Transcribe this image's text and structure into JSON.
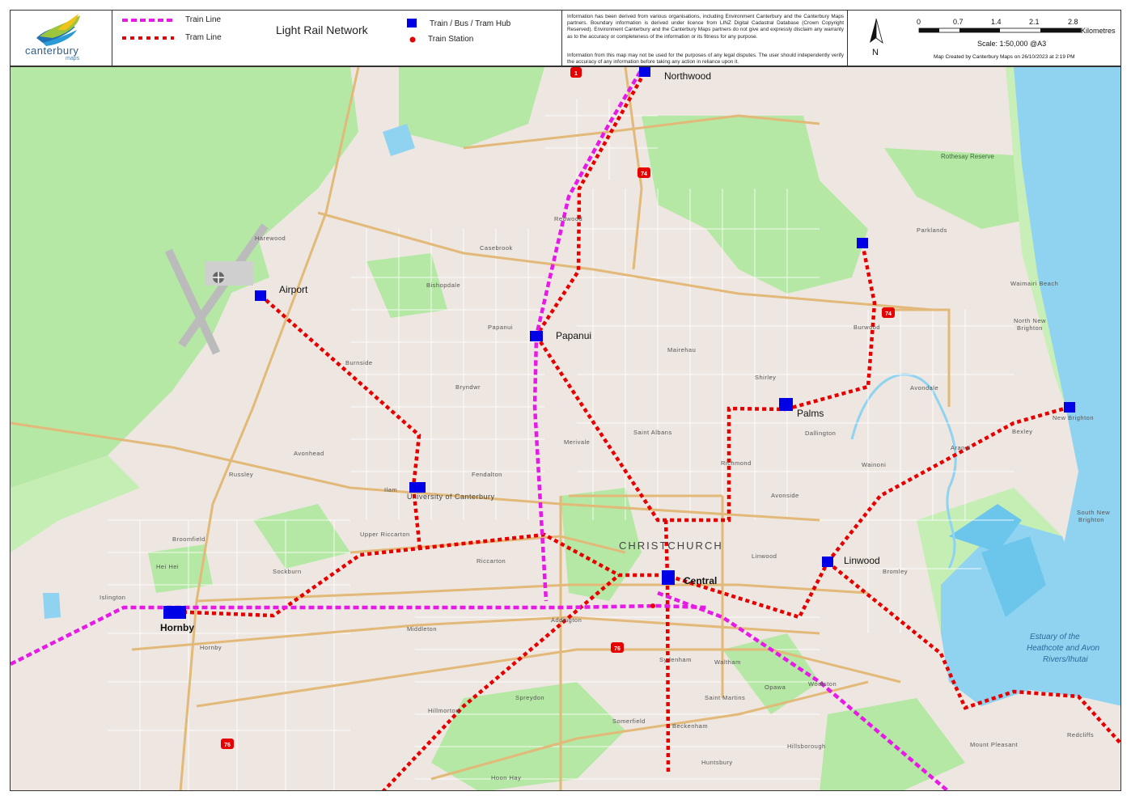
{
  "header": {
    "logo": {
      "word": "canterbury",
      "sub": "maps"
    },
    "legend": {
      "train_line": "Train Line",
      "tram_line": "Tram Line",
      "hub": "Train / Bus / Tram Hub",
      "station": "Train Station"
    },
    "title": "Light Rail Network",
    "disclaimer": [
      "Information has been derived from various organisations, including Environment Canterbury and the Canterbury Maps partners. Boundary information is derived under licence from LINZ Digital Cadastral Database (Crown Copyright Reserved). Environment Canterbury and the Canterbury Maps partners do not give and expressly disclaim any warranty as to the accuracy or completeness of the information or its fitness for any purpose.",
      "Information from this map may not be used for the purposes of any legal disputes. The user should independently verify the accuracy of any information before taking any action in reliance upon it."
    ],
    "north": "N",
    "scale": {
      "ticks": [
        "0",
        "0.7",
        "1.4",
        "2.1",
        "2.8"
      ],
      "unit": "Kilometres",
      "ratio": "Scale: 1:50,000 @A3"
    },
    "created": "Map Created by Canterbury Maps on 26/10/2023 at 2:19 PM"
  },
  "colors": {
    "train": "#e619e6",
    "tram": "#e60000",
    "hub": "#0000e6",
    "water": "#8fd3f0",
    "park": "#b4e8a4",
    "land": "#eee7e1",
    "road": "#e2b978"
  },
  "hubs": {
    "northwood": "Northwood",
    "airport": "Airport",
    "papanui": "Papanui",
    "palms": "Palms",
    "university": "University of Canterbury",
    "hornby": "Hornby",
    "central": "Central",
    "linwood": "Linwood"
  },
  "places": {
    "christchurch": "CHRISTCHURCH",
    "estuary": [
      "Estuary of the",
      "Heathcote and Avon",
      "Rivers/Ihutai"
    ],
    "rothesay": "Rothesay Reserve",
    "harewood": "Harewood",
    "redwood": "Redwood",
    "casebrook": "Casebrook",
    "bishopdale": "Bishopdale",
    "papanui": "Papanui",
    "burnside": "Burnside",
    "bryndwr": "Bryndwr",
    "mairehau": "Mairehau",
    "shirley": "Shirley",
    "parklands": "Parklands",
    "burwood": "Burwood",
    "waimairi": "Waimairi Beach",
    "north_new_brighton": [
      "North New",
      "Brighton"
    ],
    "avondale": "Avondale",
    "new_brighton": "New Brighton",
    "dallington": "Dallington",
    "st_albans": "Saint Albans",
    "merivale": "Merivale",
    "avonhead": "Avonhead",
    "russley": "Russley",
    "fendalton": "Fendalton",
    "ilam": "Ilam",
    "richmond": "Richmond",
    "wainoni": "Wainoni",
    "aranui": "Aranui",
    "bexley": "Bexley",
    "avonside": "Avonside",
    "south_new_brighton": [
      "South New",
      "Brighton"
    ],
    "broomfield": "Broomfield",
    "upper_riccarton": "Upper Riccarton",
    "hei_hei": "Hei Hei",
    "sockburn": "Sockburn",
    "riccarton": "Riccarton",
    "linwood": "Linwood",
    "bromley": "Bromley",
    "islington": "Islington",
    "middleton": "Middleton",
    "addington": "Addington",
    "hornby": "Hornby",
    "sydenham": "Sydenham",
    "waltham": "Waltham",
    "opawa": "Opawa",
    "woolston": "Woolston",
    "spreydon": "Spreydon",
    "saint_martins": "Saint Martins",
    "hillmorton": "Hillmorton",
    "somerfield": "Somerfield",
    "beckenham": "Beckenham",
    "hillsborough": "Hillsborough",
    "mount_pleasant": "Mount Pleasant",
    "redcliffs": "Redcliffs",
    "huntsbury": "Huntsbury",
    "hoon_hay": "Hoon Hay"
  },
  "routes": {
    "sh1": "1",
    "sh74a": "74",
    "sh74b": "74",
    "sh76a": "76",
    "sh76b": "76"
  }
}
